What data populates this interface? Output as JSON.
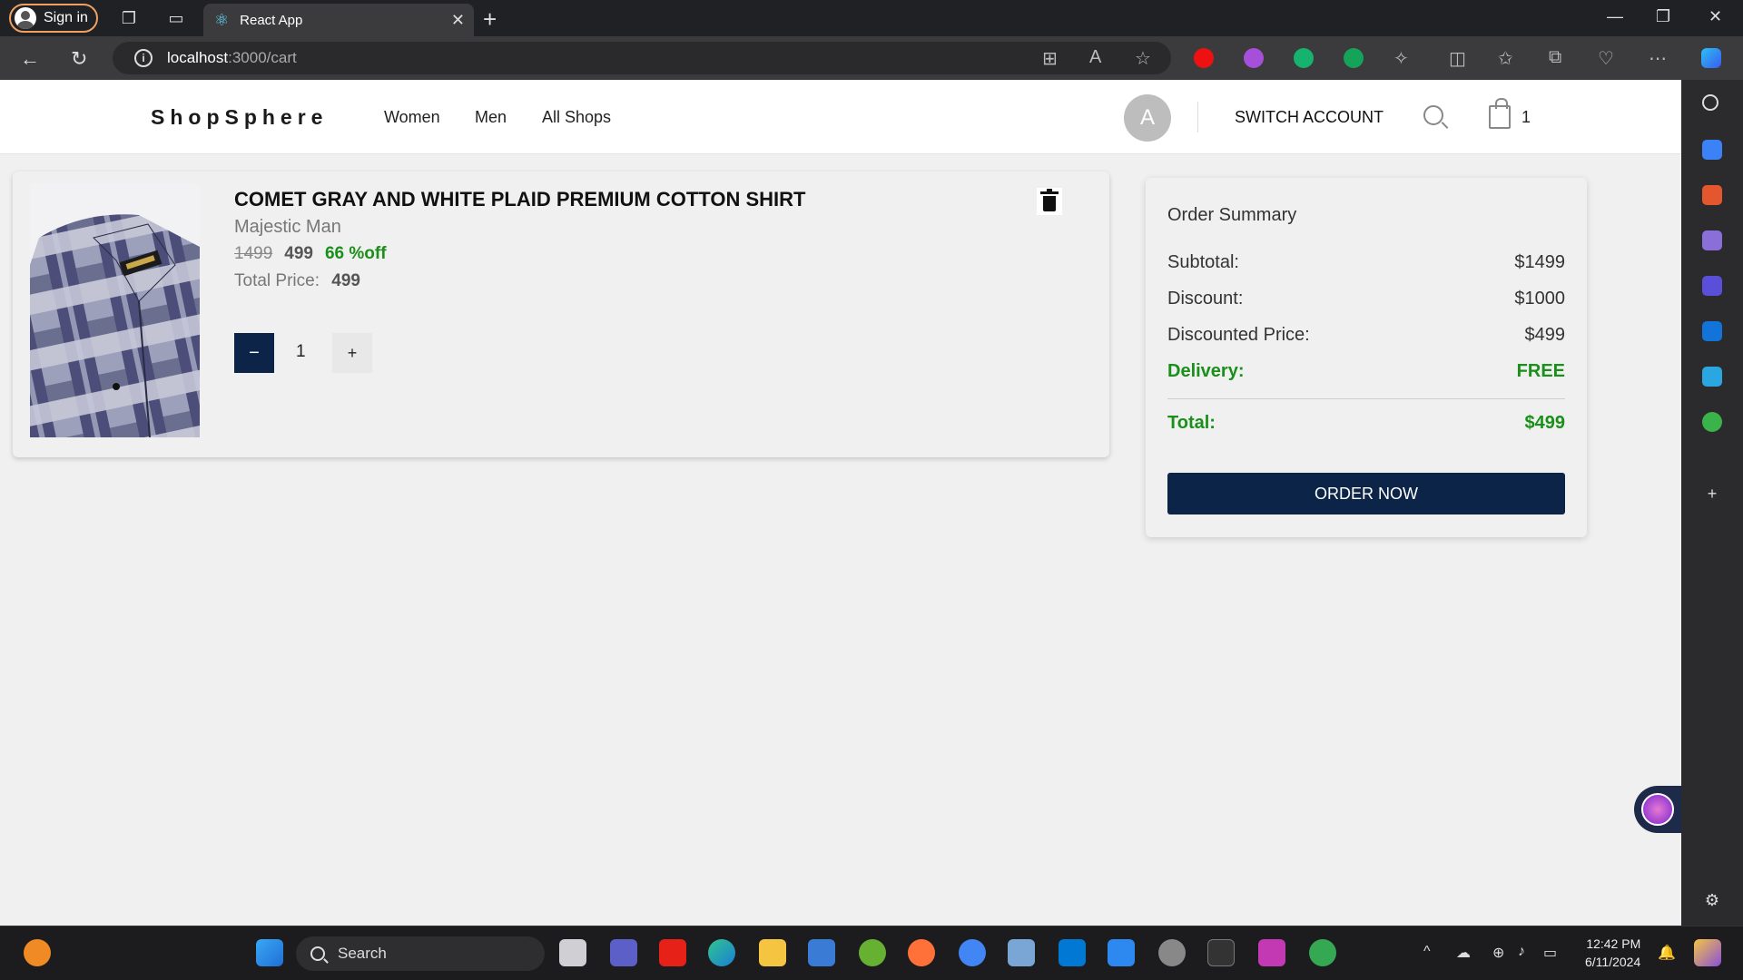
{
  "browser": {
    "signin_label": "Sign in",
    "tab_title": "React App",
    "url_host": "localhost",
    "url_path": ":3000/cart"
  },
  "header": {
    "logo": "ShopSphere",
    "nav": [
      "Women",
      "Men",
      "All Shops"
    ],
    "avatar_initial": "A",
    "switch_account": "SWITCH ACCOUNT",
    "cart_count": "1"
  },
  "cart": {
    "item": {
      "title": "COMET GRAY AND WHITE PLAID PREMIUM COTTON SHIRT",
      "brand": "Majestic Man",
      "mrp": "1499",
      "price": "499",
      "discount": "66 %off",
      "total_label": "Total Price:",
      "total_value": "499",
      "quantity": "1",
      "minus": "−",
      "plus": "+"
    }
  },
  "summary": {
    "title": "Order Summary",
    "subtotal_label": "Subtotal:",
    "subtotal_value": "$1499",
    "discount_label": "Discount:",
    "discount_value": "$1000",
    "discounted_label": "Discounted Price:",
    "discounted_value": "$499",
    "delivery_label": "Delivery:",
    "delivery_value": "FREE",
    "total_label": "Total:",
    "total_value": "$499",
    "order_button": "ORDER NOW"
  },
  "taskbar": {
    "search_label": "Search",
    "time": "12:42 PM",
    "date": "6/11/2024"
  },
  "colors": {
    "primary": "#0b2447",
    "success": "#1a8f1a"
  }
}
